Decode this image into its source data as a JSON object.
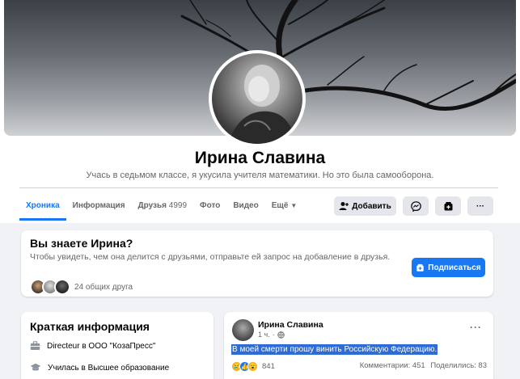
{
  "profile": {
    "name": "Ирина Славина",
    "bio": "Учась в седьмом классе, я укусила учителя математики. Но это была самооборона."
  },
  "tabs": [
    {
      "label": "Хроника",
      "count": ""
    },
    {
      "label": "Информация",
      "count": ""
    },
    {
      "label": "Друзья",
      "count": "4999"
    },
    {
      "label": "Фото",
      "count": ""
    },
    {
      "label": "Видео",
      "count": ""
    },
    {
      "label": "Ещё",
      "count": ""
    }
  ],
  "actions": {
    "add_label": "Добавить",
    "more_label": "···"
  },
  "know": {
    "title": "Вы знаете Ирина?",
    "text": "Чтобы увидеть, чем она делится с друзьями, отправьте ей запрос на добавление в друзья.",
    "mutual": "24 общих друга",
    "subscribe_label": "Подписаться"
  },
  "info": {
    "title": "Краткая информация",
    "work": "Directeur в ООО \"КозаПресс\"",
    "education": "Училась в Высшее образование"
  },
  "post": {
    "author": "Ирина Славина",
    "time": "1 ч.",
    "separator": "·",
    "text": "В моей смерти прошу винить Российскую Федерацию.",
    "reactions_count": "841",
    "comments": "Комментарии: 451",
    "shares": "Поделились: 83",
    "more_label": "···"
  },
  "colors": {
    "accent": "#1877f2",
    "page_bg": "#f0f2f5",
    "secondary_text": "#65676b",
    "button_bg": "#e4e6eb",
    "highlight": "#2d6bd6"
  },
  "icons": {
    "add_friend": "add-friend-icon",
    "messenger": "messenger-icon",
    "follow": "follow-icon",
    "work": "briefcase-icon",
    "education": "graduation-cap-icon",
    "privacy": "globe-icon"
  }
}
